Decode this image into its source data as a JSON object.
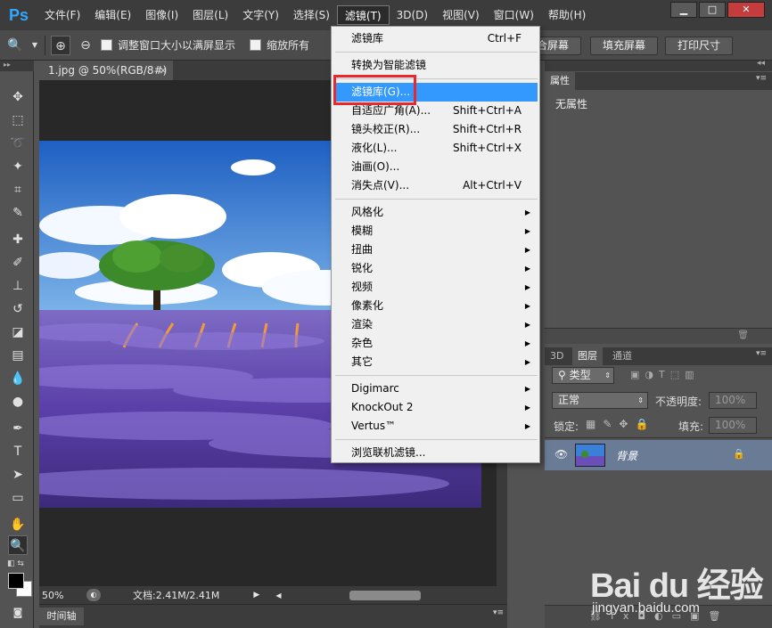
{
  "app": {
    "logo": "Ps"
  },
  "menubar": {
    "items": [
      "文件(F)",
      "编辑(E)",
      "图像(I)",
      "图层(L)",
      "文字(Y)",
      "选择(S)",
      "滤镜(T)",
      "3D(D)",
      "视图(V)",
      "窗口(W)",
      "帮助(H)"
    ],
    "active_index": 6
  },
  "window_controls": {
    "minimize": "▁",
    "maximize": "□",
    "close": "✕"
  },
  "options_bar": {
    "resize_windows_label": "调整窗口大小以满屏显示",
    "zoom_all_label": "缩放所有",
    "fit_screen": "合屏幕",
    "fill_screen": "填充屏幕",
    "print_size": "打印尺寸"
  },
  "document": {
    "tab_title": "1.jpg @ 50%(RGB/8#)",
    "tab_close": "×",
    "zoom": "50%",
    "doc_info": "文档:2.41M/2.41M"
  },
  "timeline": {
    "tab_label": "时间轴"
  },
  "properties_panel": {
    "tab_label": "属性",
    "content": "无属性"
  },
  "layers_panel": {
    "tabs": [
      "3D",
      "图层",
      "通道"
    ],
    "active_tab": 1,
    "filter_label": "类型",
    "blend_mode": "正常",
    "opacity_label": "不透明度:",
    "opacity_value": "100%",
    "lock_label": "锁定:",
    "fill_label": "填充:",
    "fill_value": "100%",
    "layers": [
      {
        "name": "背景",
        "locked": true
      }
    ]
  },
  "filter_menu": {
    "items": [
      {
        "label": "滤镜库",
        "shortcut": "Ctrl+F"
      },
      {
        "separator": true
      },
      {
        "label": "转换为智能滤镜"
      },
      {
        "separator": true
      },
      {
        "label": "滤镜库(G)...",
        "highlighted": true
      },
      {
        "label": "自适应广角(A)...",
        "shortcut": "Shift+Ctrl+A"
      },
      {
        "label": "镜头校正(R)...",
        "shortcut": "Shift+Ctrl+R"
      },
      {
        "label": "液化(L)...",
        "shortcut": "Shift+Ctrl+X"
      },
      {
        "label": "油画(O)..."
      },
      {
        "label": "消失点(V)...",
        "shortcut": "Alt+Ctrl+V"
      },
      {
        "separator": true
      },
      {
        "label": "风格化",
        "submenu": true
      },
      {
        "label": "模糊",
        "submenu": true
      },
      {
        "label": "扭曲",
        "submenu": true
      },
      {
        "label": "锐化",
        "submenu": true
      },
      {
        "label": "视频",
        "submenu": true
      },
      {
        "label": "像素化",
        "submenu": true
      },
      {
        "label": "渲染",
        "submenu": true
      },
      {
        "label": "杂色",
        "submenu": true
      },
      {
        "label": "其它",
        "submenu": true
      },
      {
        "separator": true
      },
      {
        "label": "Digimarc",
        "submenu": true
      },
      {
        "label": "KnockOut 2",
        "submenu": true
      },
      {
        "label": "Vertus™",
        "submenu": true
      },
      {
        "separator": true
      },
      {
        "label": "浏览联机滤镜..."
      }
    ]
  },
  "watermark": {
    "brand": "Bai du 经验",
    "url": "jingyan.baidu.com"
  },
  "colors": {
    "accent": "#3399ff",
    "highlight_box": "#e8282d",
    "ps_blue": "#31a8ff"
  }
}
